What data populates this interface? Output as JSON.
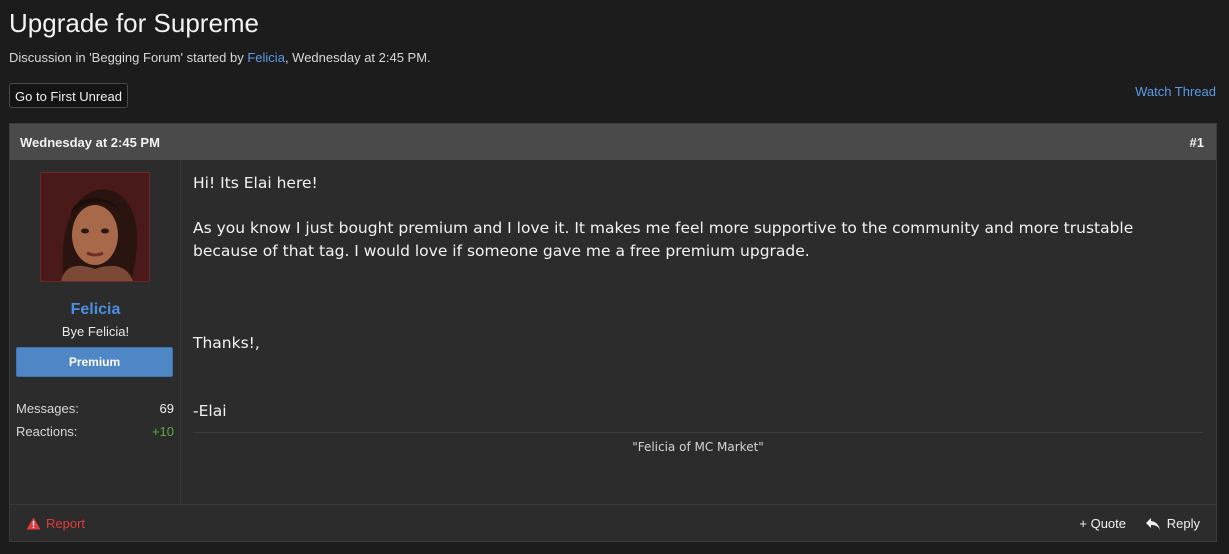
{
  "thread": {
    "title": "Upgrade for Supreme",
    "meta_prefix": "Discussion in 'Begging Forum' started by ",
    "meta_author": "Felicia",
    "meta_suffix": ", Wednesday at 2:45 PM."
  },
  "toolbar": {
    "first_unread_label": "Go to First Unread",
    "watch_thread_label": "Watch Thread"
  },
  "post": {
    "date": "Wednesday at 2:45 PM",
    "number": "#1",
    "user": {
      "name": "Felicia",
      "title": "Bye Felicia!",
      "banner": "Premium",
      "messages_label": "Messages:",
      "messages_value": "69",
      "reactions_label": "Reactions:",
      "reactions_value": "+10"
    },
    "body": {
      "line1": "Hi! Its Elai here!",
      "line2": "As you know I just bought premium and I love it. It makes me feel more supportive to the community and more trustable because of that tag. I would love if someone gave me a free premium upgrade.",
      "line3": "Thanks!,",
      "line4": "-Elai"
    },
    "signature": "\"Felicia of MC Market\"",
    "footer": {
      "report_label": "Report",
      "quote_label": "+ Quote",
      "reply_label": "Reply"
    }
  },
  "colors": {
    "link": "#5b9be6",
    "username": "#4c8fe0",
    "premium_banner": "#4f86c6",
    "report": "#e23b3b",
    "reactions_positive": "#5fa84a"
  },
  "icons": {
    "report": "warning-triangle-icon",
    "reply": "reply-arrow-icon"
  }
}
